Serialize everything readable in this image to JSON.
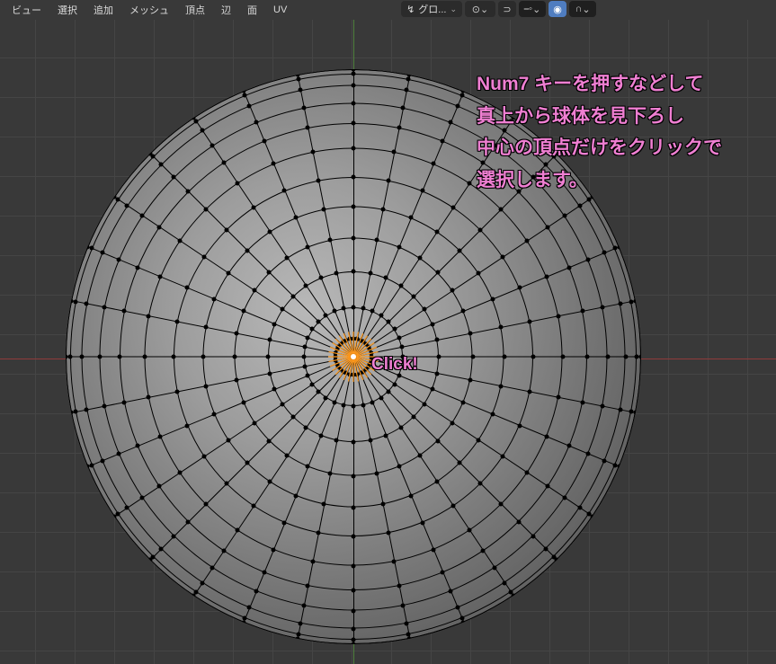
{
  "menu": {
    "view": "ビュー",
    "select": "選択",
    "add": "追加",
    "mesh": "メッシュ",
    "vertex": "頂点",
    "edge": "辺",
    "face": "面",
    "uv": "UV"
  },
  "toolbar": {
    "orientation_label": "グロ...",
    "pivot_chev": "⌄",
    "snap_glyph": "⊙",
    "snap_target": "⎯◦",
    "propedit_glyph": "◉",
    "falloff_glyph": "∩"
  },
  "geometry": {
    "segments": 32,
    "rings": [
      40,
      110,
      190,
      265,
      335,
      400,
      465,
      520,
      565,
      605,
      630,
      640
    ]
  },
  "annotation": {
    "line1": "Num7 キーを押すなどして",
    "line2": "真上から球体を見下ろし",
    "line3": "中心の頂点だけをクリックで",
    "line4": "選択します。",
    "click": "Click!"
  },
  "colors": {
    "accent": "#ef7fd2",
    "select": "#ff9a1f"
  }
}
